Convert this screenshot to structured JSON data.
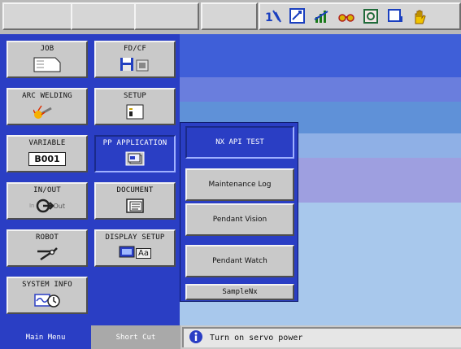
{
  "colors": {
    "panel_blue": "#2a3ec4",
    "stripe_colors": [
      "#3f5fd8",
      "#6a7edd",
      "#5f91d8",
      "#8fb0e6",
      "#9e9fe0",
      "#a8c8ec"
    ]
  },
  "topbar": {
    "status_icons": [
      "robot-coordinate-icon",
      "variable-edit-icon",
      "chart-icon",
      "glasses-icon",
      "tool-icon",
      "page-icon",
      "hand-icon"
    ]
  },
  "main_menu": {
    "items": [
      {
        "label": "JOB",
        "icon": "job-document-icon"
      },
      {
        "label": "FD/CF",
        "icon": "floppy-disk-icon"
      },
      {
        "label": "ARC WELDING",
        "icon": "arc-welding-icon"
      },
      {
        "label": "SETUP",
        "icon": "setup-icon"
      },
      {
        "label": "VARIABLE",
        "value": "B001",
        "icon": "variable-icon"
      },
      {
        "label": "PP APPLICATION",
        "icon": "pp-application-icon"
      },
      {
        "label": "IN/OUT",
        "sub_in": "In",
        "sub_out": "Out",
        "icon": "in-out-icon"
      },
      {
        "label": "DOCUMENT",
        "icon": "document-icon"
      },
      {
        "label": "ROBOT",
        "icon": "robot-arm-icon"
      },
      {
        "label": "DISPLAY SETUP",
        "sub": "Aa",
        "icon": "display-setup-icon"
      },
      {
        "label": "SYSTEM INFO",
        "icon": "system-info-icon"
      }
    ]
  },
  "popup_menu": {
    "items": [
      {
        "label": "NX API TEST"
      },
      {
        "label": "Maintenance Log"
      },
      {
        "label": "Pendant Vision"
      },
      {
        "label": "Pendant Watch"
      },
      {
        "label": "SampleNx"
      }
    ]
  },
  "bottom_bar": {
    "main_menu_label": "Main Menu",
    "short_cut_label": "Short Cut",
    "message": "Turn on servo power",
    "message_icon": "info-icon"
  }
}
